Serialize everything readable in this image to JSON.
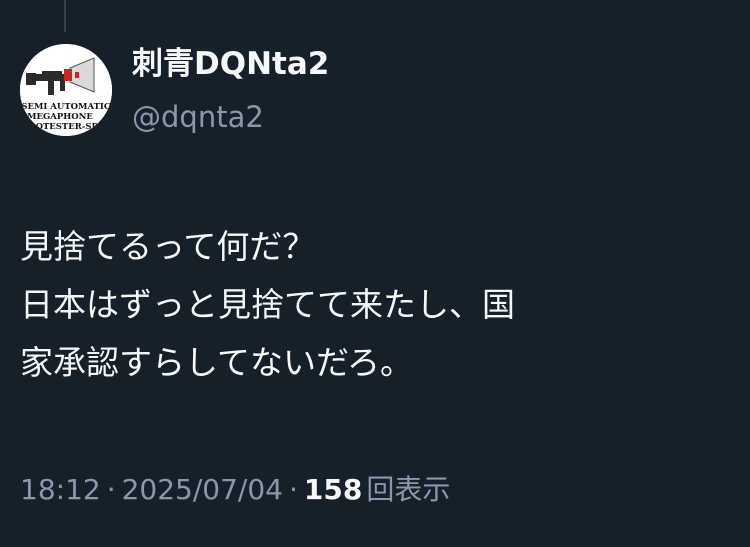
{
  "author": {
    "display_name": "刺青DQNta2",
    "handle": "@dqnta2",
    "avatar_text": {
      "line1": "SEMI AUTOMATIC",
      "line2": "MEGAPHONE",
      "line3": "PROTESTER-SP"
    }
  },
  "tweet": {
    "lines": [
      "見捨てるって何だ？",
      "日本はずっと見捨てて来たし、国",
      "家承認すらしてないだろ。"
    ]
  },
  "meta": {
    "time": "18:12",
    "separator": "·",
    "date": "2025/07/04",
    "views_count": "158",
    "views_label": "回表示"
  },
  "colors": {
    "background": "#15202b",
    "text_primary": "#f7f9f9",
    "text_secondary": "#8b98a5"
  }
}
